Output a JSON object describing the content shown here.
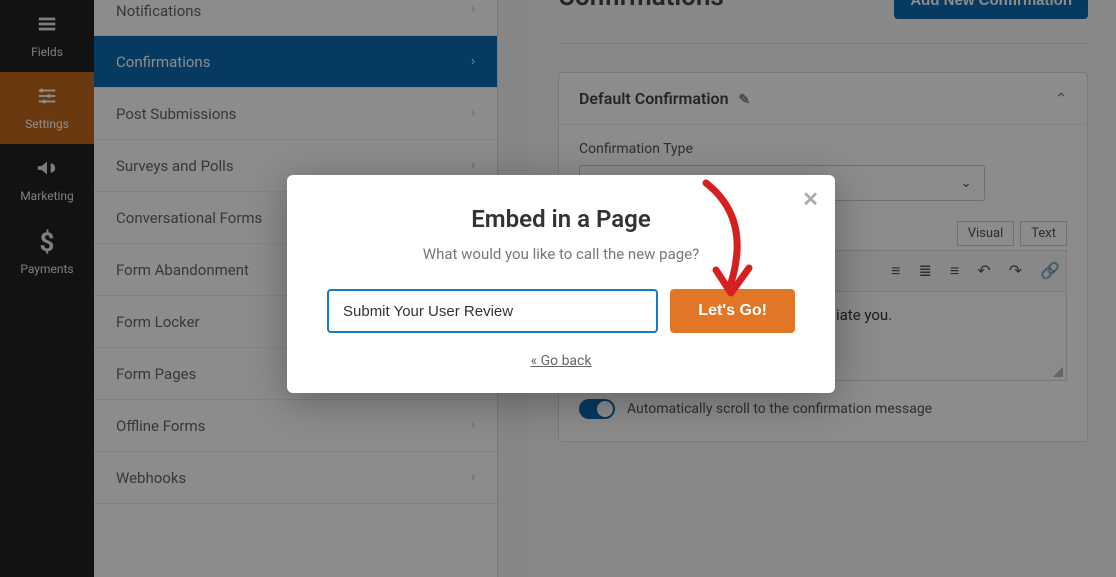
{
  "leftbar": [
    {
      "name": "fields",
      "label": "Fields",
      "icon": "▤"
    },
    {
      "name": "settings",
      "label": "Settings",
      "icon": "⚙",
      "active": true
    },
    {
      "name": "marketing",
      "label": "Marketing",
      "icon": "📣"
    },
    {
      "name": "payments",
      "label": "Payments",
      "icon": "$"
    }
  ],
  "submenu": [
    {
      "name": "notifications",
      "label": "Notifications",
      "partial": true
    },
    {
      "name": "confirmations",
      "label": "Confirmations",
      "active": true
    },
    {
      "name": "post-submissions",
      "label": "Post Submissions"
    },
    {
      "name": "surveys-polls",
      "label": "Surveys and Polls"
    },
    {
      "name": "conversational",
      "label": "Conversational Forms"
    },
    {
      "name": "form-abandonment",
      "label": "Form Abandonment"
    },
    {
      "name": "form-locker",
      "label": "Form Locker"
    },
    {
      "name": "form-pages",
      "label": "Form Pages"
    },
    {
      "name": "offline-forms",
      "label": "Offline Forms"
    },
    {
      "name": "webhooks",
      "label": "Webhooks"
    }
  ],
  "main": {
    "title": "Confirmations",
    "add_btn": "Add New Confirmation",
    "card_title": "Default Confirmation",
    "field_label": "Confirmation Type",
    "tab_visual": "Visual",
    "tab_text": "Text",
    "editor_text": "iate you.",
    "toggle_label": "Automatically scroll to the confirmation message"
  },
  "modal": {
    "title": "Embed in a Page",
    "subtitle": "What would you like to call the new page?",
    "input_value": "Submit Your User Review",
    "button": "Let's Go!",
    "back": "« Go back"
  }
}
